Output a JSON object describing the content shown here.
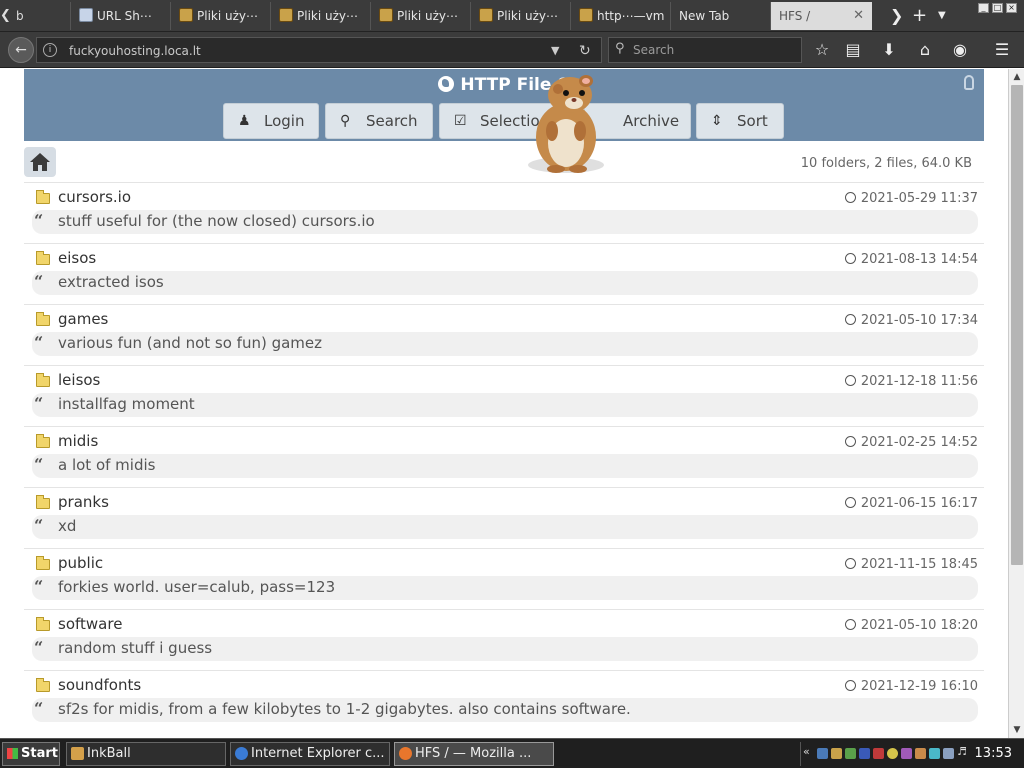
{
  "browser": {
    "tabs": [
      {
        "label": "b",
        "favicon": "page-icon"
      },
      {
        "label": "URL Sh⋯",
        "favicon": "url-shortener-icon"
      },
      {
        "label": "Pliki uży⋯",
        "favicon": "hfs-icon"
      },
      {
        "label": "Pliki uży⋯",
        "favicon": "hfs-icon"
      },
      {
        "label": "Pliki uży⋯",
        "favicon": "hfs-icon"
      },
      {
        "label": "Pliki uży⋯",
        "favicon": "hfs-icon"
      },
      {
        "label": "http⋯—vm",
        "favicon": "hfs-icon"
      },
      {
        "label": "New Tab",
        "favicon": ""
      },
      {
        "label": "HFS /",
        "favicon": "",
        "active": true
      }
    ],
    "url_prefix": "fuckyouhosting.",
    "url_domain": "loca.lt",
    "search_placeholder": "Search"
  },
  "page": {
    "title": "HTTP File S",
    "buttons": {
      "login": "Login",
      "search": "Search",
      "selection": "Selectio",
      "archive": "Archive",
      "sort": "Sort"
    },
    "summary": "10 folders, 2 files, 64.0 KB",
    "items": [
      {
        "name": "cursors.io",
        "date": "2021-05-29 11:37",
        "comment": "stuff useful for (the now closed) cursors.io"
      },
      {
        "name": "eisos",
        "date": "2021-08-13 14:54",
        "comment": "extracted isos"
      },
      {
        "name": "games",
        "date": "2021-05-10 17:34",
        "comment": "various fun (and not so fun) gamez"
      },
      {
        "name": "leisos",
        "date": "2021-12-18 11:56",
        "comment": "installfag moment"
      },
      {
        "name": "midis",
        "date": "2021-02-25 14:52",
        "comment": "a lot of midis"
      },
      {
        "name": "pranks",
        "date": "2021-06-15 16:17",
        "comment": "xd"
      },
      {
        "name": "public",
        "date": "2021-11-15 18:45",
        "comment": "forkies world. user=calub, pass=123"
      },
      {
        "name": "software",
        "date": "2021-05-10 18:20",
        "comment": "random stuff i guess"
      },
      {
        "name": "soundfonts",
        "date": "2021-12-19 16:10",
        "comment": "sf2s for midis, from a few kilobytes to 1-2 gigabytes. also contains software."
      }
    ]
  },
  "taskbar": {
    "start": "Start",
    "tasks": [
      {
        "label": "InkBall"
      },
      {
        "label": "Internet Explorer c..."
      },
      {
        "label": "HFS / — Mozilla ...",
        "active": true
      }
    ],
    "clock": "13:53"
  },
  "colors": {
    "header_bg": "#6c8aa8",
    "button_bg": "#dde4ea",
    "chrome_dark": "#3b3b3b"
  }
}
